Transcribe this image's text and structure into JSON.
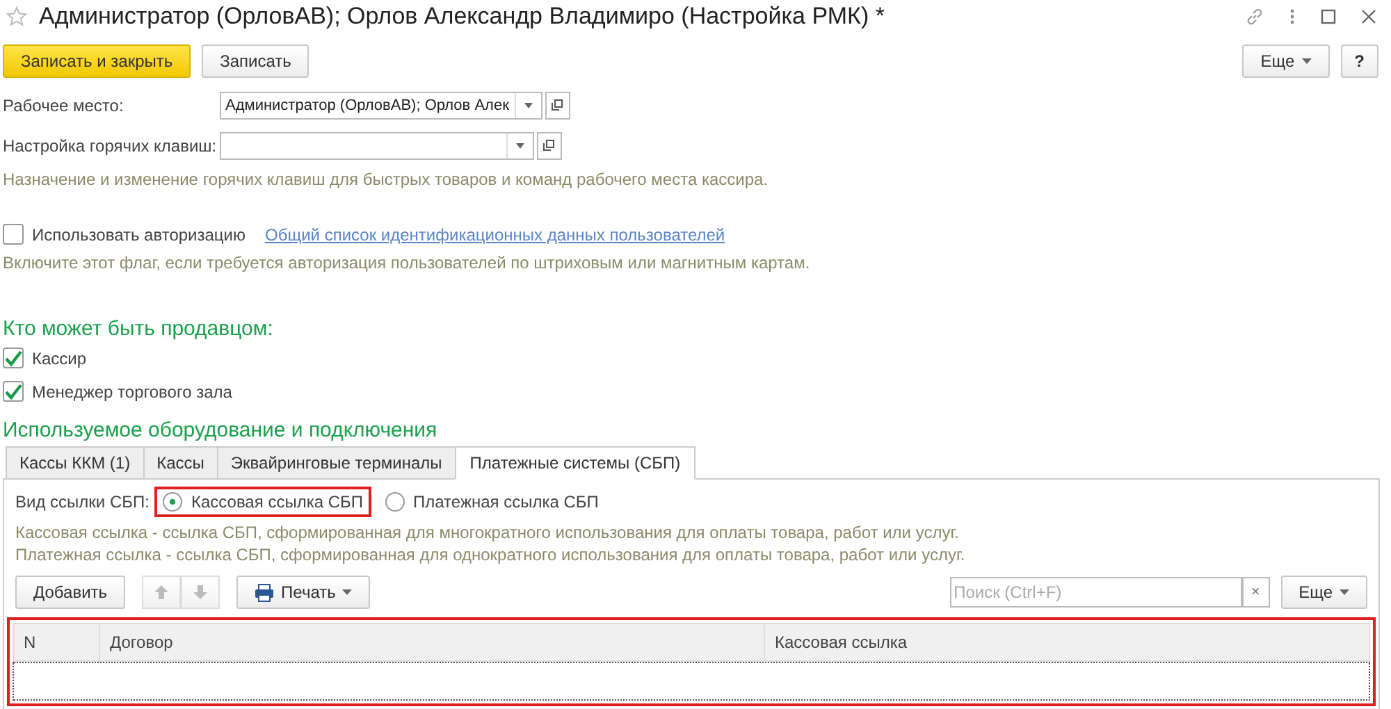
{
  "window": {
    "title": "Администратор (ОрловАВ); Орлов Александр Владимиро (Настройка РМК) *",
    "favorite": false
  },
  "toolbar": {
    "buttons": [
      {
        "label": "Записать и закрыть",
        "kind": "primary"
      },
      {
        "label": "Записать",
        "kind": "normal"
      }
    ],
    "more": "Еще",
    "help": "?"
  },
  "fields": [
    {
      "label": "Рабочее место:",
      "value": "Администратор (ОрловАВ); Орлов Алек"
    },
    {
      "label": "Настройка горячих клавиш:"
    }
  ],
  "hotkeys_hint": "Назначение и изменение горячих клавиш для быстрых товаров и команд рабочего места кассира.",
  "auth": {
    "label": "Использовать авторизацию",
    "checked": false,
    "link": "Общий список идентификационных данных пользователей",
    "hint": "Включите этот флаг, если требуется авторизация пользователей по штриховым или магнитным картам."
  },
  "sellers": {
    "heading": "Кто может быть продавцом:",
    "items": [
      {
        "label": "Кассир",
        "checked": true
      },
      {
        "label": "Менеджер торгового зала",
        "checked": true
      }
    ]
  },
  "equipment": {
    "heading": "Используемое оборудование и подключения",
    "tabs": [
      {
        "label": "Кассы ККМ (1)",
        "selected": false
      },
      {
        "label": "Кассы",
        "selected": false
      },
      {
        "label": "Эквайринговые терминалы",
        "selected": false
      },
      {
        "label": "Платежные системы (СБП)",
        "selected": true
      }
    ],
    "link_type": {
      "label": "Вид ссылки СБП:",
      "options": [
        {
          "label": "Кассовая ссылка СБП",
          "selected": true,
          "highlighted": true
        },
        {
          "label": "Платежная ссылка СБП",
          "selected": false,
          "highlighted": false
        }
      ]
    },
    "hints": [
      "Кассовая ссылка - ссылка СБП, сформированная для многократного использования для оплаты товара, работ или услуг.",
      "Платежная ссылка - ссылка СБП, сформированная для однократного использования для оплаты товара, работ или услуг."
    ],
    "table_toolbar": {
      "add": "Добавить",
      "print": "Печать",
      "search_placeholder": "Поиск (Ctrl+F)",
      "clear": "×",
      "more": "Еще"
    },
    "table": {
      "highlighted": true,
      "columns": [
        "N",
        "Договор",
        "Кассовая ссылка"
      ]
    }
  }
}
